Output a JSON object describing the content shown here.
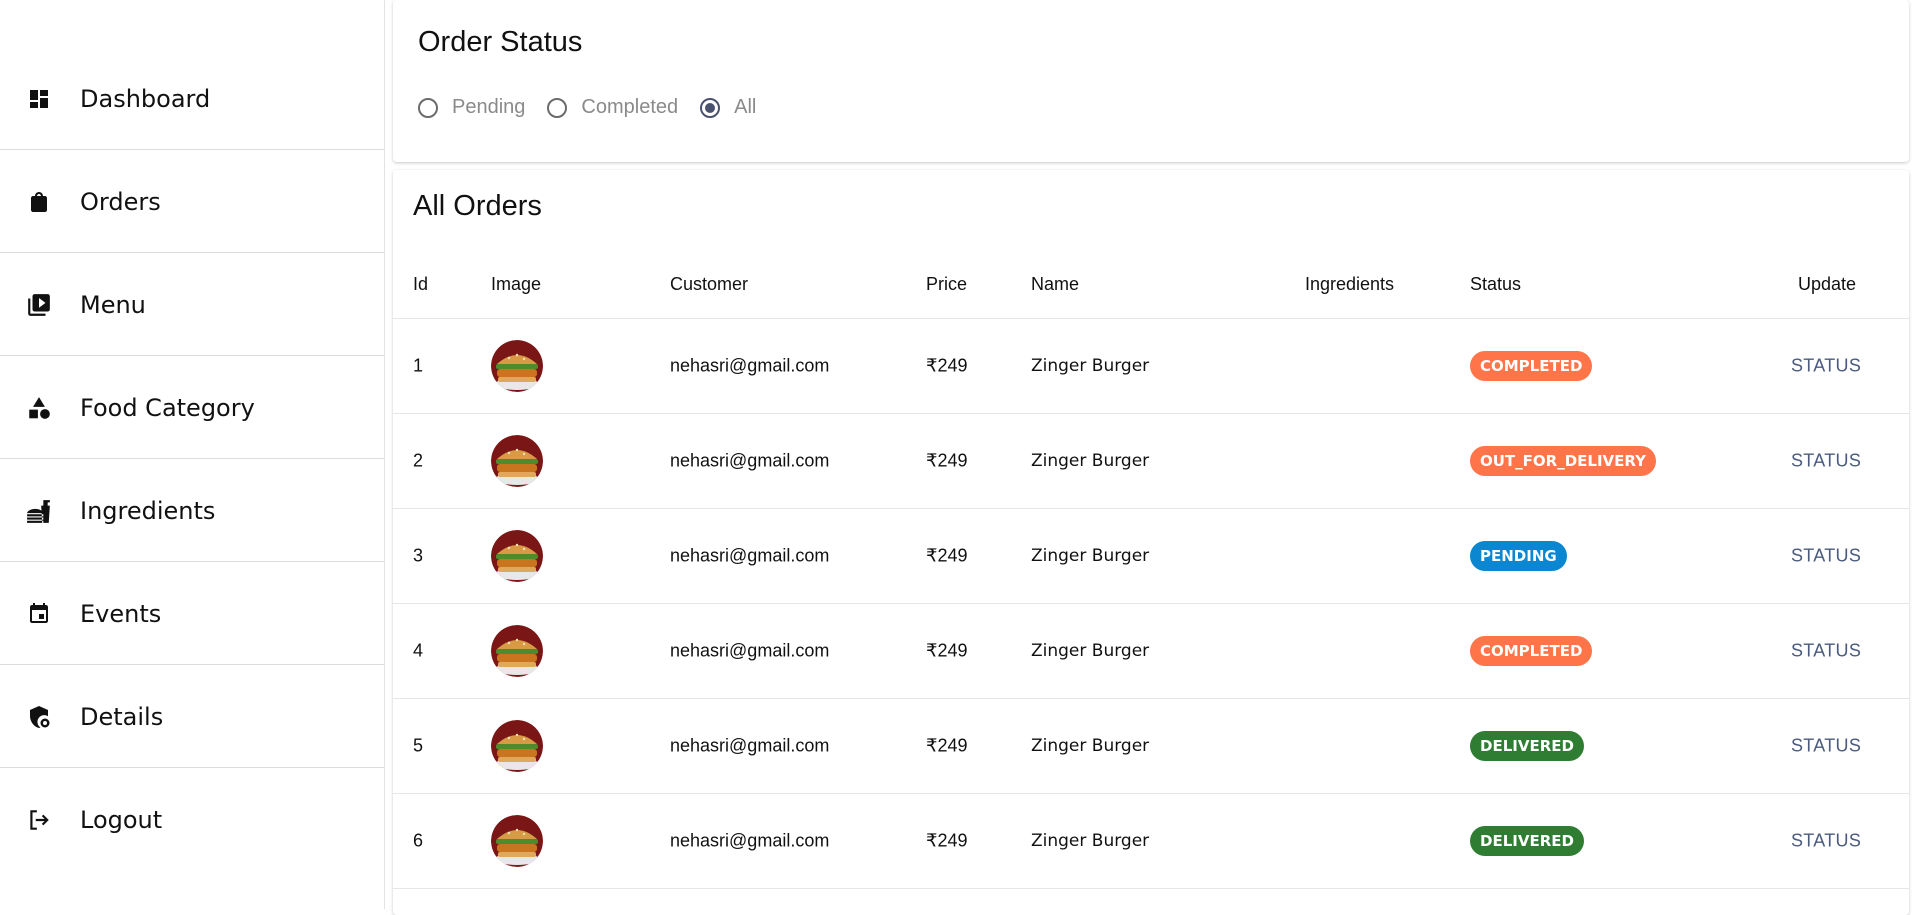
{
  "sidebar": {
    "items": [
      {
        "label": "Dashboard",
        "icon": "dashboard-icon"
      },
      {
        "label": "Orders",
        "icon": "shopping-bag-icon"
      },
      {
        "label": "Menu",
        "icon": "menu-book-icon"
      },
      {
        "label": "Food Category",
        "icon": "category-icon"
      },
      {
        "label": "Ingredients",
        "icon": "ingredients-icon"
      },
      {
        "label": "Events",
        "icon": "calendar-icon"
      },
      {
        "label": "Details",
        "icon": "details-shield-icon"
      },
      {
        "label": "Logout",
        "icon": "logout-icon"
      }
    ]
  },
  "order_status": {
    "title": "Order Status",
    "options": [
      {
        "label": "Pending",
        "checked": false
      },
      {
        "label": "Completed",
        "checked": false
      },
      {
        "label": "All",
        "checked": true
      }
    ]
  },
  "orders": {
    "title": "All Orders",
    "headers": {
      "id": "Id",
      "image": "Image",
      "customer": "Customer",
      "price": "Price",
      "name": "Name",
      "ingredients": "Ingredients",
      "status": "Status",
      "update": "Update"
    },
    "rows": [
      {
        "id": "1",
        "customer": "nehasri@gmail.com",
        "price": "₹249",
        "name": "Zinger Burger",
        "ingredients": "",
        "status": "COMPLETED",
        "update": "STATUS"
      },
      {
        "id": "2",
        "customer": "nehasri@gmail.com",
        "price": "₹249",
        "name": "Zinger Burger",
        "ingredients": "",
        "status": "OUT_FOR_DELIVERY",
        "update": "STATUS"
      },
      {
        "id": "3",
        "customer": "nehasri@gmail.com",
        "price": "₹249",
        "name": "Zinger Burger",
        "ingredients": "",
        "status": "PENDING",
        "update": "STATUS"
      },
      {
        "id": "4",
        "customer": "nehasri@gmail.com",
        "price": "₹249",
        "name": "Zinger Burger",
        "ingredients": "",
        "status": "COMPLETED",
        "update": "STATUS"
      },
      {
        "id": "5",
        "customer": "nehasri@gmail.com",
        "price": "₹249",
        "name": "Zinger Burger",
        "ingredients": "",
        "status": "DELIVERED",
        "update": "STATUS"
      },
      {
        "id": "6",
        "customer": "nehasri@gmail.com",
        "price": "₹249",
        "name": "Zinger Burger",
        "ingredients": "",
        "status": "DELIVERED",
        "update": "STATUS"
      }
    ]
  },
  "colors": {
    "completed": "#ff7549",
    "out_for_delivery": "#ff7549",
    "pending": "#0b86d0",
    "delivered": "#2e7d32",
    "radio_checked": "#4a5270",
    "update_text": "#4b5b7e"
  }
}
